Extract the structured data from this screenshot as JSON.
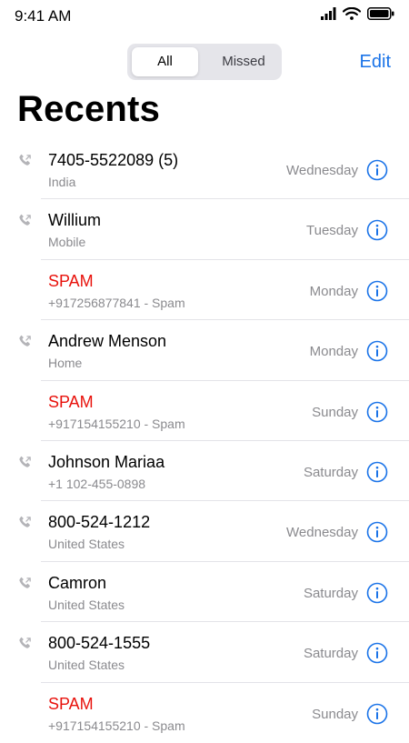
{
  "status_bar": {
    "time": "9:41 AM",
    "icons": [
      "signal-icon",
      "wifi-icon",
      "battery-icon"
    ]
  },
  "segmented_control": {
    "options": [
      "All",
      "Missed"
    ],
    "selected": "All"
  },
  "header": {
    "edit_label": "Edit",
    "title": "Recents"
  },
  "colors": {
    "accent": "#1a73e8",
    "spam": "#e8120c",
    "secondary_text": "#8a8a8e"
  },
  "calls": [
    {
      "name": "7405-5522089 (5)",
      "detail": "India",
      "day": "Wednesday",
      "spam": false,
      "outgoing_icon": true
    },
    {
      "name": "Willium",
      "detail": "Mobile",
      "day": "Tuesday",
      "spam": false,
      "outgoing_icon": true
    },
    {
      "name": "SPAM",
      "detail": "+917256877841 - Spam",
      "day": "Monday",
      "spam": true,
      "outgoing_icon": false
    },
    {
      "name": "Andrew Menson",
      "detail": "Home",
      "day": "Monday",
      "spam": false,
      "outgoing_icon": true
    },
    {
      "name": "SPAM",
      "detail": "+917154155210 - Spam",
      "day": "Sunday",
      "spam": true,
      "outgoing_icon": false
    },
    {
      "name": "Johnson Mariaa",
      "detail": "+1 102-455-0898",
      "day": "Saturday",
      "spam": false,
      "outgoing_icon": true
    },
    {
      "name": "800-524-1212",
      "detail": "United States",
      "day": "Wednesday",
      "spam": false,
      "outgoing_icon": true
    },
    {
      "name": "Camron",
      "detail": "United States",
      "day": "Saturday",
      "spam": false,
      "outgoing_icon": true
    },
    {
      "name": "800-524-1555",
      "detail": "United States",
      "day": "Saturday",
      "spam": false,
      "outgoing_icon": true
    },
    {
      "name": "SPAM",
      "detail": "+917154155210 - Spam",
      "day": "Sunday",
      "spam": true,
      "outgoing_icon": false
    }
  ]
}
